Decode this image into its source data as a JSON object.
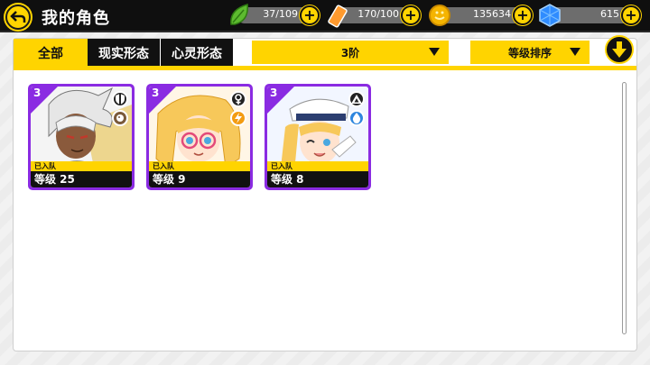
{
  "header": {
    "title": "我的角色",
    "resources": [
      {
        "name": "stamina",
        "icon": "leaf-icon",
        "value": "37/109"
      },
      {
        "name": "energy",
        "icon": "battery-icon",
        "value": "170/100"
      },
      {
        "name": "gold",
        "icon": "coin-icon",
        "value": "135634"
      },
      {
        "name": "crystal",
        "icon": "crystal-icon",
        "value": "615"
      }
    ],
    "plus_symbol": "+"
  },
  "tabs": [
    {
      "label": "全部",
      "active": true
    },
    {
      "label": "现实形态",
      "active": false
    },
    {
      "label": "心灵形态",
      "active": false
    }
  ],
  "filters": {
    "tier_value": "3阶",
    "sort_value": "等级排序"
  },
  "characters": [
    {
      "grade": "3",
      "status": "已入队",
      "level": "等级 25",
      "badge1": "shield-icon",
      "badge2": "ghost-icon",
      "badge2_color": "#7a5a3a"
    },
    {
      "grade": "3",
      "status": "已入队",
      "level": "等级 9",
      "badge1": "female-symbol-icon",
      "badge2": "lightning-icon",
      "badge2_color": "#f39c12"
    },
    {
      "grade": "3",
      "status": "已入队",
      "level": "等级 8",
      "badge1": "triangle-icon",
      "badge2": "water-drop-icon",
      "badge2_color": "#2e86de"
    }
  ],
  "colors": {
    "accent": "#ffd400",
    "card_frame": "#8a2be2",
    "topbar": "#0f0f0f"
  }
}
